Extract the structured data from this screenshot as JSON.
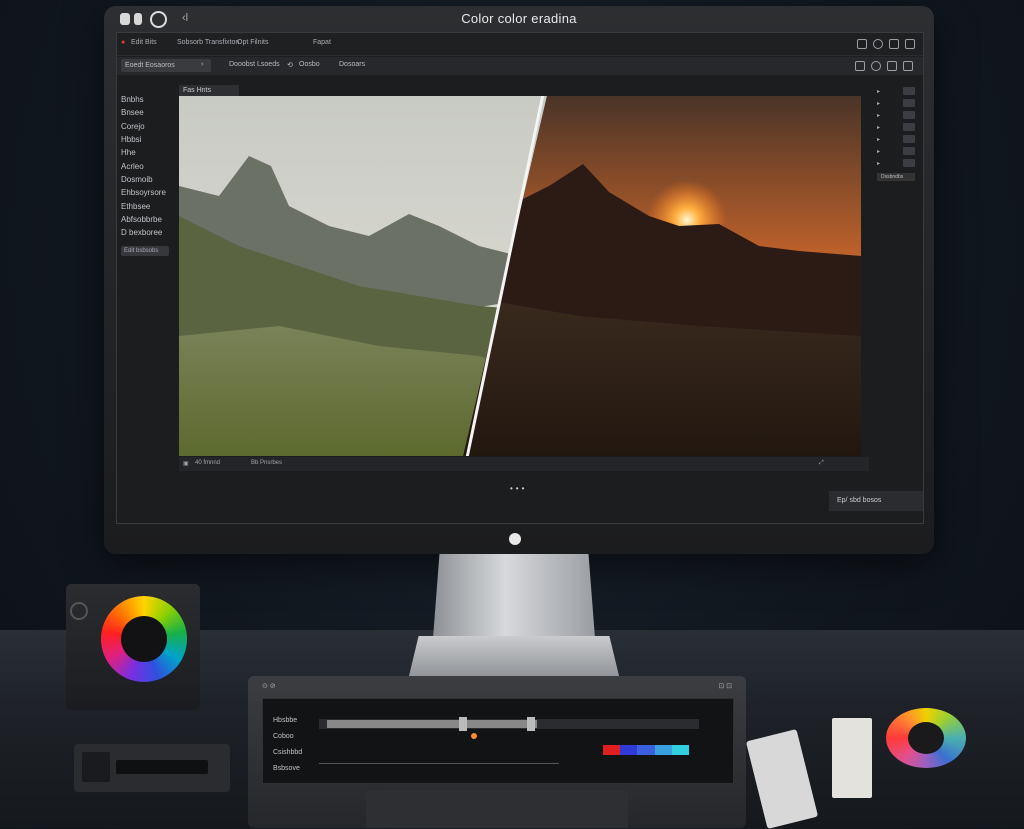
{
  "window": {
    "title": "Color color eradina"
  },
  "app": {
    "menu": [
      "Edit Bits",
      "Sobsorb Transfixton",
      "Opt Filnits",
      "Fapat"
    ],
    "toolbar": {
      "preset_label": "Eoedt Eosaoros",
      "tab1": "Dooobst Lsoeds",
      "tab2": "Oosbo",
      "tab3": "Dosoars"
    },
    "viewer_tab": "Fas Hnts",
    "sidebar": [
      "Bnbhs",
      "Bnsee",
      "Corejo",
      "Hbbsi",
      "Hhe",
      "Acrleo",
      "Dosmoib",
      "Ehbsoyrsore",
      "Ethbsee",
      "Abfsobbrbe",
      "D bexboree"
    ],
    "sidebar_button": "Edit bsbsobs",
    "status": {
      "left": "40 fmnnd",
      "right": "Bb Pnsrbes"
    },
    "export": "Ep/ sbd bosos",
    "right_panel_button": "Dssbndbs"
  },
  "surface": {
    "rows": [
      "Hbsbbe",
      "Coboo",
      "Csishbbd",
      "Bsbsove"
    ],
    "colors": [
      "#e02020",
      "#2f3ad8",
      "#3a60e0",
      "#3aa0e0",
      "#30d0e0"
    ]
  },
  "colors": {
    "accent": "#ff8a30",
    "bg": "#121820"
  }
}
